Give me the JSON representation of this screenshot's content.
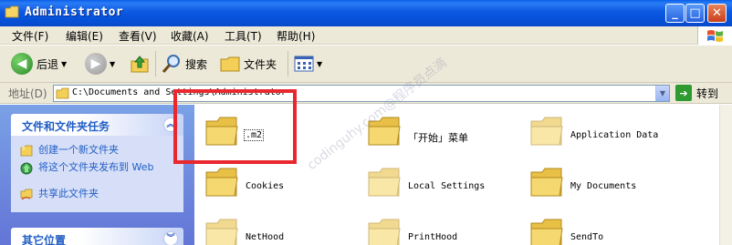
{
  "window": {
    "title": "Administrator",
    "buttons": {
      "minimize": "_",
      "maximize": "□",
      "close": "✕"
    }
  },
  "menu": [
    {
      "label": "文件(F)"
    },
    {
      "label": "编辑(E)"
    },
    {
      "label": "查看(V)"
    },
    {
      "label": "收藏(A)"
    },
    {
      "label": "工具(T)"
    },
    {
      "label": "帮助(H)"
    }
  ],
  "toolbar": {
    "back_label": "后退",
    "search_label": "搜索",
    "folders_label": "文件夹"
  },
  "address": {
    "label": "地址(D)",
    "path": "C:\\Documents and Settings\\Administrator",
    "go_label": "转到"
  },
  "tasks_panel": {
    "title": "文件和文件夹任务",
    "items": [
      {
        "label": "创建一个新文件夹",
        "icon": "new-folder-icon"
      },
      {
        "label": "将这个文件夹发布到 Web",
        "icon": "publish-web-icon"
      },
      {
        "label": "共享此文件夹",
        "icon": "share-folder-icon"
      }
    ]
  },
  "other_places_panel": {
    "title": "其它位置"
  },
  "files": [
    {
      "name": ".m2",
      "selected": true
    },
    {
      "name": "「开始」菜单",
      "selected": false
    },
    {
      "name": "Application Data",
      "selected": false
    },
    {
      "name": "Cookies",
      "selected": false
    },
    {
      "name": "Local Settings",
      "selected": false
    },
    {
      "name": "My Documents",
      "selected": false
    },
    {
      "name": "NetHood",
      "selected": false
    },
    {
      "name": "PrintHood",
      "selected": false
    },
    {
      "name": "SendTo",
      "selected": false
    }
  ],
  "watermark": "codinguhy.com@程序员点滴",
  "colors": {
    "titlebar": "#0a5fe8",
    "highlight": "#e8282e",
    "task_link": "#215dc6"
  }
}
